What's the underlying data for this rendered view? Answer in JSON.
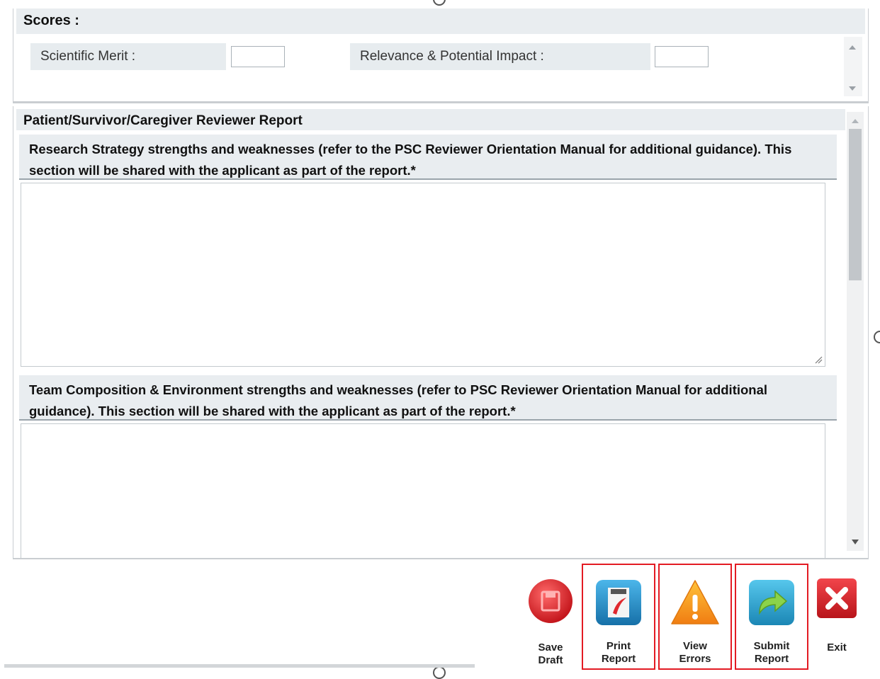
{
  "scores": {
    "title": "Scores :",
    "scientific_merit_label": "Scientific Merit :",
    "scientific_merit_value": "",
    "relevance_label": "Relevance & Potential Impact :",
    "relevance_value": ""
  },
  "report": {
    "title": "Patient/Survivor/Caregiver Reviewer Report",
    "sections": [
      {
        "header": "Research Strategy strengths and weaknesses (refer to the PSC Reviewer Orientation Manual for additional guidance). This section will be shared with the applicant as part of the report.*",
        "value": ""
      },
      {
        "header": "Team Composition & Environment strengths and weaknesses (refer to PSC Reviewer Orientation Manual for additional guidance). This section will be shared with the applicant as part of the report.*",
        "value": ""
      }
    ]
  },
  "toolbar": {
    "buttons": [
      {
        "line1": "Save",
        "line2": "Draft",
        "icon": "save-icon",
        "highlighted": false
      },
      {
        "line1": "Print",
        "line2": "Report",
        "icon": "pdf-icon",
        "highlighted": true
      },
      {
        "line1": "View",
        "line2": "Errors",
        "icon": "warning-icon",
        "highlighted": true
      },
      {
        "line1": "Submit",
        "line2": "Report",
        "icon": "submit-arrow-icon",
        "highlighted": true
      },
      {
        "line1": "Exit",
        "line2": "",
        "icon": "close-icon",
        "highlighted": false
      }
    ]
  },
  "colors": {
    "highlight_outline": "#e31b23",
    "header_background": "#e9edf0",
    "save_red": "#d9252b",
    "pdf_blue": "#1f8fd0",
    "warning_orange": "#f39a1e",
    "submit_teal": "#2ba3c8",
    "exit_red": "#d8232a"
  }
}
